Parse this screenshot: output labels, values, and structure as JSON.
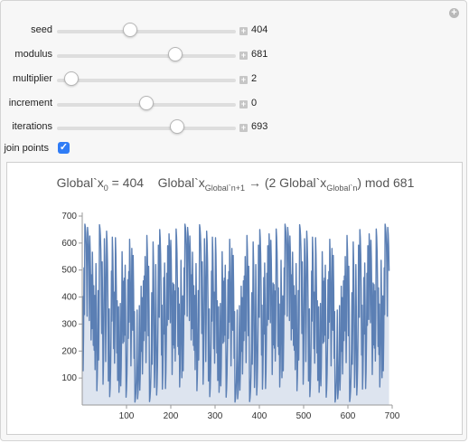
{
  "controls": [
    {
      "id": "seed",
      "label": "seed",
      "value": "404",
      "pos": 0.41
    },
    {
      "id": "modulus",
      "label": "modulus",
      "value": "681",
      "pos": 0.66
    },
    {
      "id": "multiplier",
      "label": "multiplier",
      "value": "2",
      "pos": 0.08
    },
    {
      "id": "increment",
      "label": "increment",
      "value": "0",
      "pos": 0.5
    },
    {
      "id": "iterations",
      "label": "iterations",
      "value": "693",
      "pos": 0.67
    }
  ],
  "join_points": {
    "label": "join points",
    "checked": true,
    "mark": "✓"
  },
  "formula": {
    "x0_prefix": "Global`x",
    "x0_sub": "0",
    "x0_rest": " = 404",
    "rec_prefix": "Global`x",
    "rec_sub": "Global`n+1",
    "rec_mid": " → (2 Global`x",
    "rec_sub2": "Global`n",
    "rec_end": ") mod 681"
  },
  "icons": {
    "corner": "plus-circle-icon",
    "stepper": "plus-square-icon"
  },
  "chart_data": {
    "type": "line",
    "filled": true,
    "n": 693,
    "seed": 404,
    "multiplier": 2,
    "increment": 0,
    "modulus": 681,
    "xlim": [
      0,
      700
    ],
    "ylim": [
      0,
      700
    ],
    "xticks": [
      100,
      200,
      300,
      400,
      500,
      600,
      700
    ],
    "yticks": [
      100,
      200,
      300,
      400,
      500,
      600,
      700
    ],
    "line_color": "#5b7fb4",
    "fill_color": "#dde4ef"
  }
}
